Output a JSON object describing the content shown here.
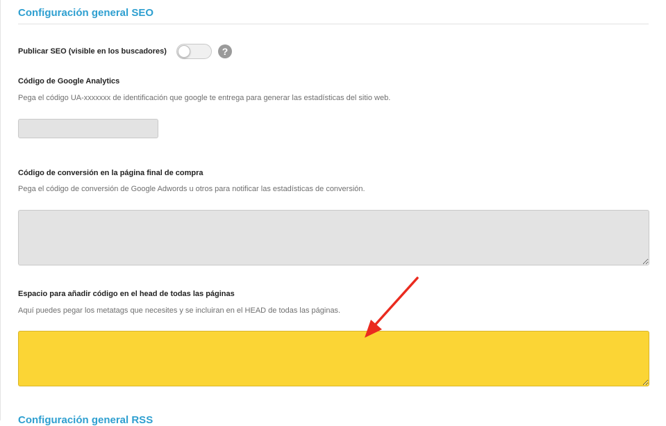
{
  "seo_section": {
    "title": "Configuración general SEO",
    "publish": {
      "label": "Publicar SEO (visible en los buscadores)",
      "enabled": false,
      "help_icon": "question-mark-icon",
      "help_glyph": "?"
    },
    "analytics": {
      "label": "Código de Google Analytics",
      "help": "Pega el código UA-xxxxxxx de identificación que google te entrega para generar las estadísticas del sitio web.",
      "value": "",
      "placeholder": ""
    },
    "conversion": {
      "label": "Código de conversión en la página final de compra",
      "help": "Pega el código de conversión de Google Adwords u otros para notificar las estadísticas de conversión.",
      "value": ""
    },
    "head_code": {
      "label": "Espacio para añadir código en el head de todas las páginas",
      "help": "Aquí puedes pegar los metatags que necesites y se incluiran en el HEAD de todas las páginas.",
      "value": ""
    }
  },
  "rss_section": {
    "title": "Configuración general RSS"
  },
  "colors": {
    "section_title": "#2e9fd0",
    "highlight_field": "#fbd535",
    "arrow": "#ea2b1f",
    "input_background": "#e3e3e3"
  }
}
